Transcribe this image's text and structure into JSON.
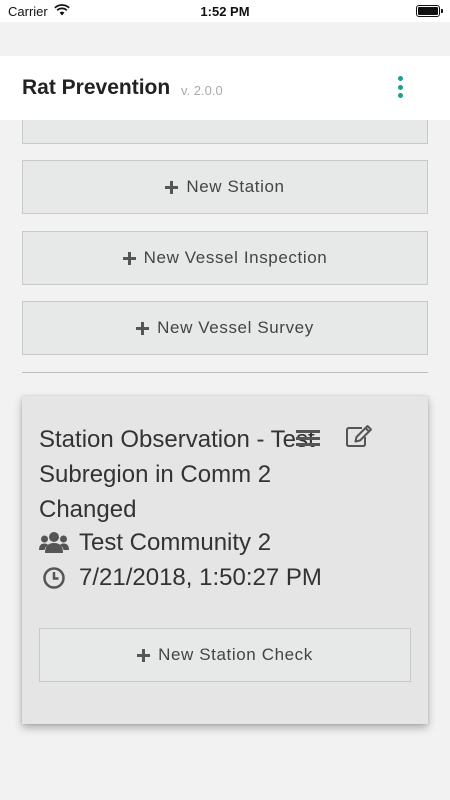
{
  "status_bar": {
    "carrier": "Carrier",
    "time": "1:52 PM"
  },
  "header": {
    "title": "Rat Prevention",
    "version": "v. 2.0.0",
    "accent_color": "#1aa18f"
  },
  "actions": {
    "new_station": "New Station",
    "new_vessel_inspection": "New Vessel Inspection",
    "new_vessel_survey": "New Vessel Survey"
  },
  "card": {
    "title": "Station Observation - Test Subregion in Comm 2 Changed",
    "community": "Test Community 2",
    "datetime": "7/21/2018, 1:50:27 PM",
    "button": "New Station Check"
  },
  "icons": [
    "wifi-icon",
    "battery-icon",
    "overflow-menu-icon",
    "plus-icon",
    "list-icon",
    "edit-icon",
    "users-icon",
    "clock-icon"
  ]
}
